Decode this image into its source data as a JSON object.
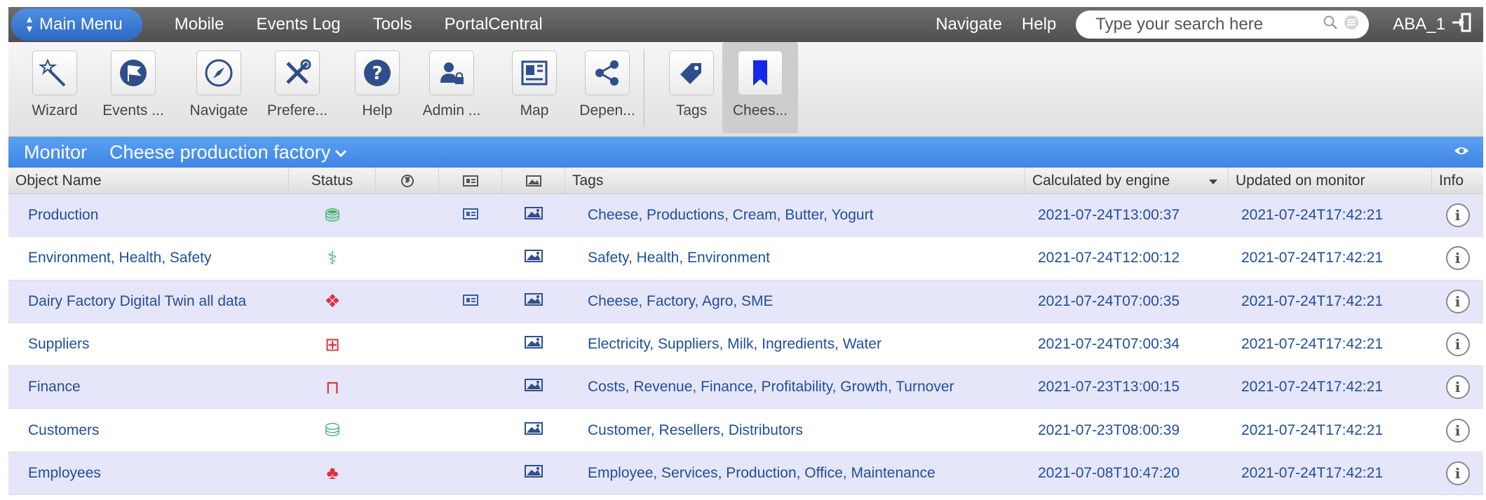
{
  "topbar": {
    "main_menu_label": "Main Menu",
    "nav": [
      "Mobile",
      "Events Log",
      "Tools",
      "PortalCentral"
    ],
    "navigate_label": "Navigate",
    "help_label": "Help",
    "search_placeholder": "Type your search here",
    "user": "ABA_1"
  },
  "toolbar": {
    "tools": [
      {
        "label": "Wizard",
        "icon": "wizard-icon"
      },
      {
        "label": "Events ...",
        "icon": "flag-icon"
      },
      {
        "label": "Navigate",
        "icon": "compass-icon"
      },
      {
        "label": "Prefere...",
        "icon": "tools-icon"
      },
      {
        "label": "Help",
        "icon": "help-icon"
      },
      {
        "label": "Admin ...",
        "icon": "admin-icon"
      },
      {
        "label": "Map",
        "icon": "map-icon"
      },
      {
        "label": "Depen...",
        "icon": "share-icon"
      },
      {
        "label": "Tags",
        "icon": "tag-icon"
      },
      {
        "label": "Chees...",
        "icon": "bookmark-icon"
      }
    ]
  },
  "monitor": {
    "label": "Monitor",
    "selected": "Cheese production factory"
  },
  "table": {
    "headers": {
      "name": "Object Name",
      "status": "Status",
      "tags": "Tags",
      "calculated": "Calculated by engine",
      "updated": "Updated on monitor",
      "info": "Info"
    },
    "rows": [
      {
        "name": "Production",
        "status_color": "#3fae6a",
        "status_glyph": "⛃",
        "has_doc": true,
        "tags": "Cheese, Productions, Cream, Butter, Yogurt",
        "calculated": "2021-07-24T13:00:37",
        "updated": "2021-07-24T17:42:21"
      },
      {
        "name": "Environment, Health, Safety",
        "status_color": "#3fae6a",
        "status_glyph": "⚕",
        "has_doc": false,
        "tags": "Safety, Health, Environment",
        "calculated": "2021-07-24T12:00:12",
        "updated": "2021-07-24T17:42:21"
      },
      {
        "name": "Dairy Factory Digital Twin all data",
        "status_color": "#e0303a",
        "status_glyph": "❖",
        "has_doc": true,
        "tags": "Cheese, Factory, Agro, SME",
        "calculated": "2021-07-24T07:00:35",
        "updated": "2021-07-24T17:42:21"
      },
      {
        "name": "Suppliers",
        "status_color": "#e0303a",
        "status_glyph": "⊞",
        "has_doc": false,
        "tags": "Electricity, Suppliers, Milk, Ingredients, Water",
        "calculated": "2021-07-24T07:00:34",
        "updated": "2021-07-24T17:42:21"
      },
      {
        "name": "Finance",
        "status_color": "#e0303a",
        "status_glyph": "⊓",
        "has_doc": false,
        "tags": "Costs, Revenue, Finance, Profitability, Growth, Turnover",
        "calculated": "2021-07-23T13:00:15",
        "updated": "2021-07-24T17:42:21"
      },
      {
        "name": "Customers",
        "status_color": "#3fae6a",
        "status_glyph": "⛁",
        "has_doc": false,
        "tags": "Customer, Resellers, Distributors",
        "calculated": "2021-07-23T08:00:39",
        "updated": "2021-07-24T17:42:21"
      },
      {
        "name": "Employees",
        "status_color": "#e0303a",
        "status_glyph": "♣",
        "has_doc": false,
        "tags": "Employee, Services, Production, Office, Maintenance",
        "calculated": "2021-07-08T10:47:20",
        "updated": "2021-07-24T17:42:21"
      }
    ]
  }
}
